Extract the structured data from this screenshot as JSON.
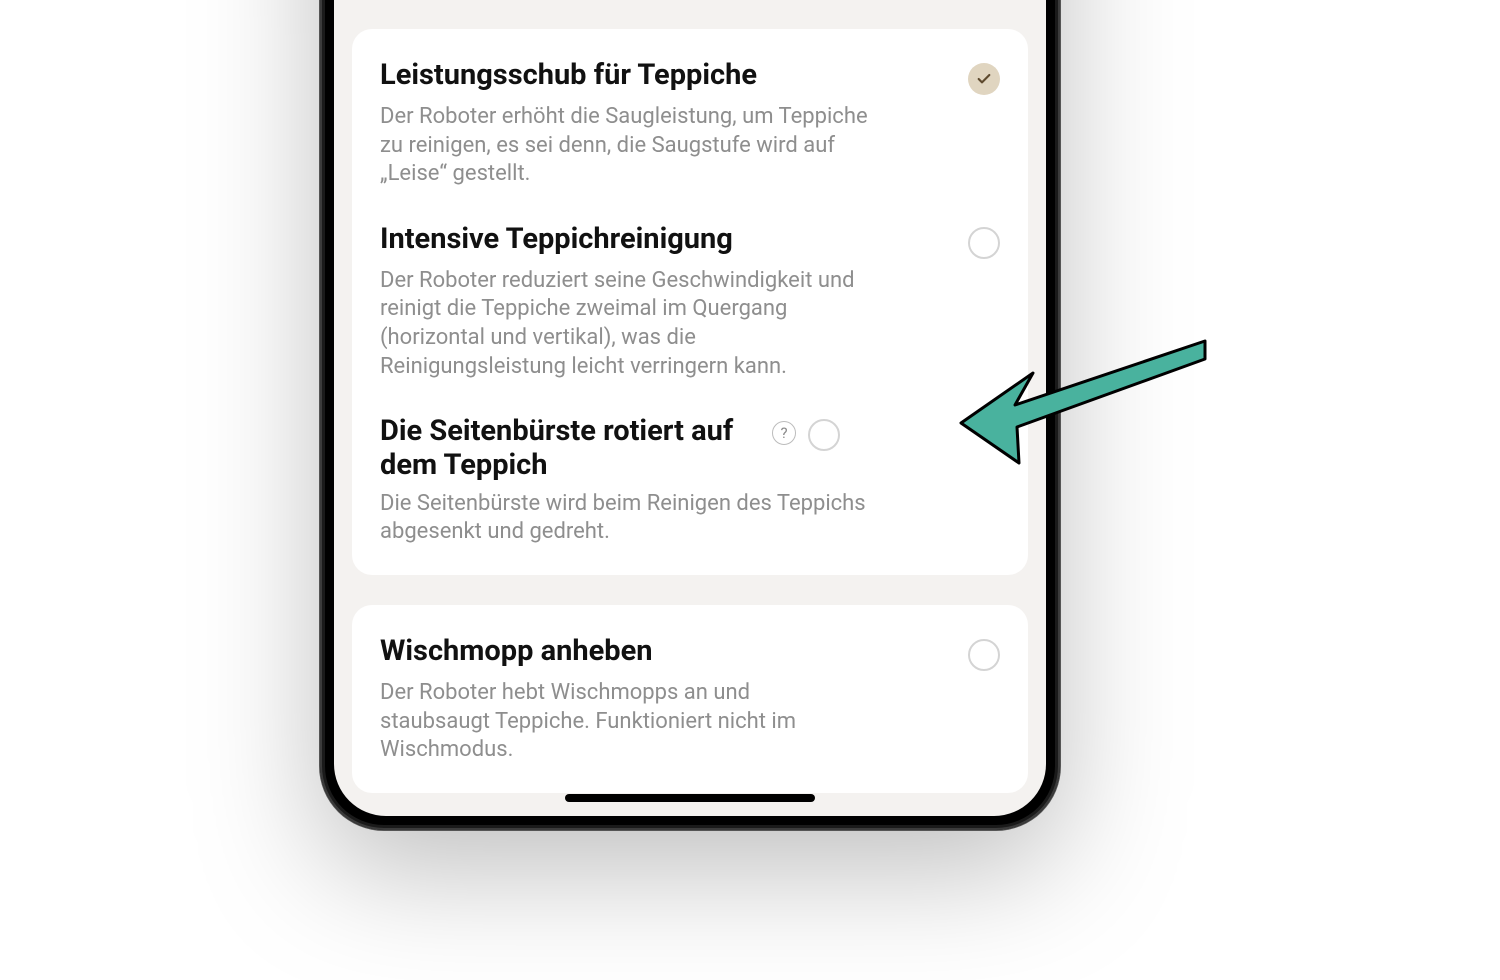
{
  "colors": {
    "accent_bg": "#e0d5c0",
    "check_fill": "#5e4a2e",
    "arrow_fill": "#49b29e",
    "arrow_stroke": "#000000"
  },
  "card1": {
    "items": [
      {
        "title": "Leistungsschub für Teppiche",
        "desc": "Der Roboter erhöht die Saugleistung, um Teppiche zu reinigen, es sei denn, die Saugstufe wird auf „Leise“ gestellt.",
        "checked": true,
        "has_help": false
      },
      {
        "title": "Intensive Teppichreinigung",
        "desc": "Der Roboter reduziert seine Geschwindigkeit und reinigt die Teppiche zweimal im Quergang (horizontal und vertikal), was die Reinigungsleistung leicht verringern kann.",
        "checked": false,
        "has_help": false
      },
      {
        "title": "Die Seitenbürste rotiert auf dem Teppich",
        "desc": "Die Seitenbürste wird beim Reinigen des Teppichs abgesenkt und gedreht.",
        "checked": false,
        "has_help": true
      }
    ]
  },
  "card2": {
    "items": [
      {
        "title": "Wischmopp anheben",
        "desc": "Der Roboter hebt Wischmopps an und staubsaugt Teppiche. Funktioniert nicht im Wischmodus.",
        "checked": false,
        "has_help": false
      }
    ]
  }
}
